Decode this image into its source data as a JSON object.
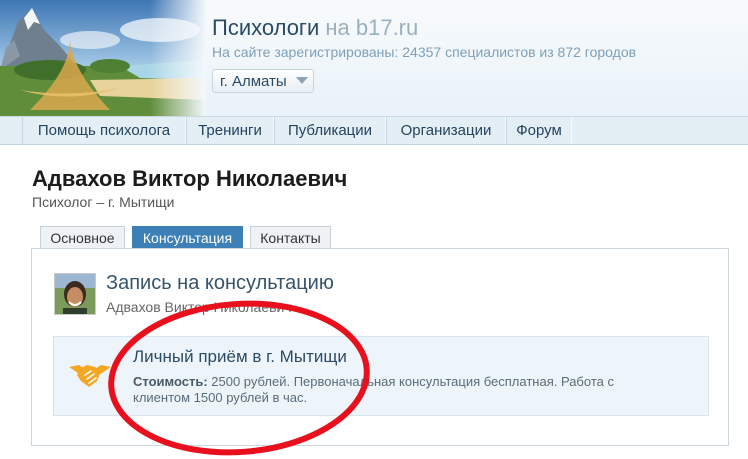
{
  "header": {
    "title_main": "Психологи",
    "title_domain": " на b17.ru",
    "stats": "На сайте зарегистрированы: 24357 специалистов из 872 городов",
    "city": "г. Алматы"
  },
  "nav": {
    "items": [
      "Помощь психолога",
      "Тренинги",
      "Публикации",
      "Организации",
      "Форум"
    ]
  },
  "profile": {
    "name": "Адвахов Виктор Николаевич",
    "subtitle": "Психолог – г. Мытищи"
  },
  "tabs": [
    "Основное",
    "Консультация",
    "Контакты"
  ],
  "consultation": {
    "title": "Запись на консультацию",
    "name": "Адвахов Виктор Николаевич",
    "card_title": "Личный приём в г. Мытищи",
    "price_label": "Стоимость:",
    "price_text": " 2500 рублей. Первоначальная консультация бесплатная. Работа с клиентом 1500 рублей в час."
  },
  "colors": {
    "active_tab": "#3d80b8",
    "annotation": "#e8101c",
    "handshake": "#f5a623"
  },
  "icons": {
    "handshake": "handshake-icon",
    "dropdown": "chevron-down-icon"
  }
}
